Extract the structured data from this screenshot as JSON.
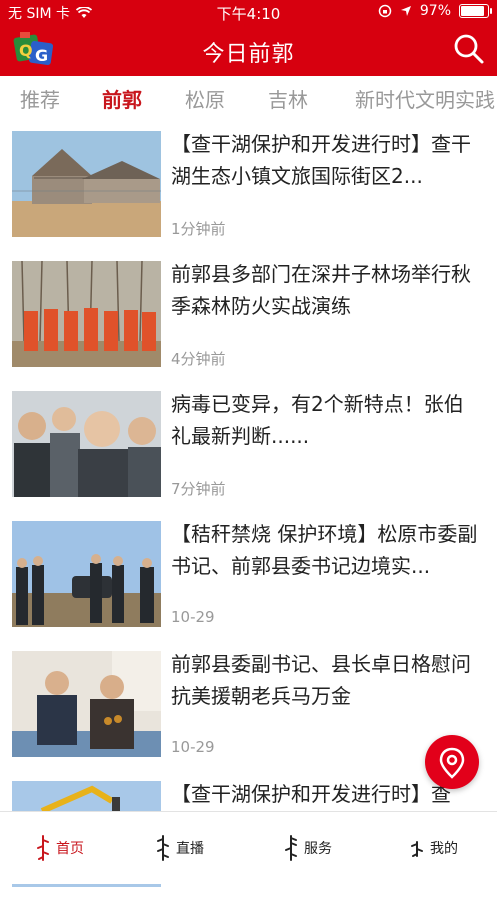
{
  "status": {
    "carrier": "无 SIM 卡",
    "time": "下午4:10",
    "battery": "97%",
    "battery_level": 0.97
  },
  "header": {
    "title": "今日前郭",
    "logo_icon": "app-logo-icon",
    "search_icon": "search-icon"
  },
  "tabs": [
    {
      "label": "推荐",
      "active": false
    },
    {
      "label": "前郭",
      "active": true
    },
    {
      "label": "松原",
      "active": false
    },
    {
      "label": "吉林",
      "active": false
    },
    {
      "label": "新时代文明实践",
      "active": false
    }
  ],
  "articles": [
    {
      "title": "【查干湖保护和开发进行时】查干湖生态小镇文旅国际街区2...",
      "time": "1分钟前"
    },
    {
      "title": "前郭县多部门在深井子林场举行秋季森林防火实战演练",
      "time": "4分钟前"
    },
    {
      "title": "病毒已变异，有2个新特点！张伯礼最新判断......",
      "time": "7分钟前"
    },
    {
      "title": "【秸秆禁烧 保护环境】松原市委副书记、前郭县委书记边境实...",
      "time": "10-29"
    },
    {
      "title": "前郭县委副书记、县长卓日格慰问抗美援朝老兵马万金",
      "time": "10-29"
    },
    {
      "title": "【查干湖保护和开发进行时】查",
      "time": ""
    }
  ],
  "fab": {
    "icon": "location-pin-icon"
  },
  "tabbar": [
    {
      "label": "首页",
      "active": true
    },
    {
      "label": "直播",
      "active": false
    },
    {
      "label": "服务",
      "active": false
    },
    {
      "label": "我的",
      "active": false
    }
  ],
  "colors": {
    "brand": "#d7000f",
    "active_tab": "#c8161d"
  }
}
